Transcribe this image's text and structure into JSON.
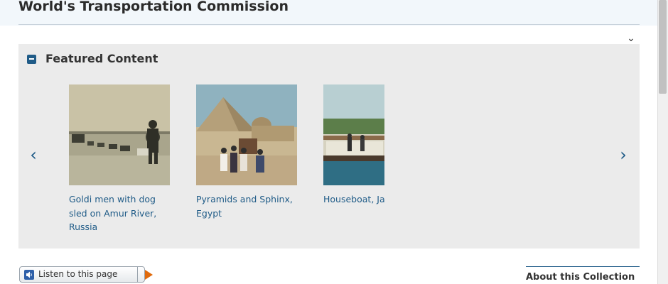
{
  "header": {
    "title": "World's Transportation Commission"
  },
  "featured": {
    "heading": "Featured Content",
    "items": [
      {
        "caption": "Goldi men with dog sled on Amur River, Russia"
      },
      {
        "caption": "Pyramids and Sphinx, Egypt"
      },
      {
        "caption": "Houseboat, Ja"
      }
    ]
  },
  "listen": {
    "label": "Listen to this page"
  },
  "about": {
    "title": "About this Collection"
  },
  "icons": [
    "chevron-down-icon",
    "collapse-minus-icon",
    "chevron-left-icon",
    "chevron-right-icon",
    "speaker-icon",
    "play-icon"
  ],
  "colors": {
    "accent": "#1f5b87",
    "panel": "#ebebeb",
    "header_band": "#f2f7fb",
    "play": "#e06a0c"
  }
}
